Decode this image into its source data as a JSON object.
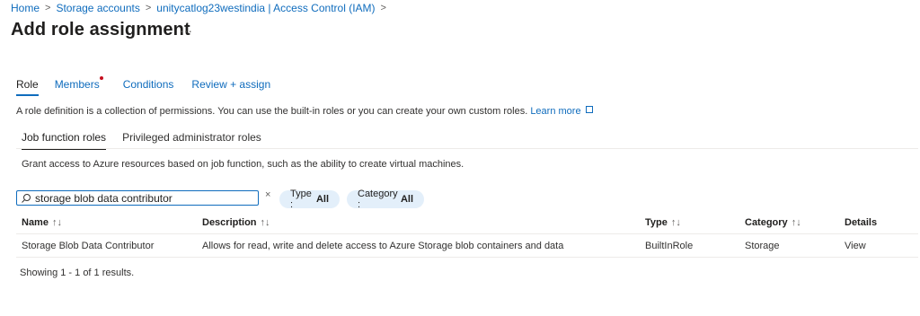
{
  "breadcrumb": {
    "items": [
      "Home",
      "Storage accounts",
      "unitycatlog23westindia | Access Control (IAM)"
    ],
    "separator": ">"
  },
  "page": {
    "title": "Add role assignment",
    "more": "···"
  },
  "tabs": [
    {
      "label": "Role",
      "active": true
    },
    {
      "label": "Members",
      "active": false,
      "required_dot": true
    },
    {
      "label": "Conditions",
      "active": false
    },
    {
      "label": "Review + assign",
      "active": false
    }
  ],
  "role_description": {
    "text": "A role definition is a collection of permissions. You can use the built-in roles or you can create your own custom roles.",
    "link": "Learn more"
  },
  "subtabs": [
    {
      "label": "Job function roles",
      "active": true
    },
    {
      "label": "Privileged administrator roles",
      "active": false
    }
  ],
  "subtab_description": "Grant access to Azure resources based on job function, such as the ability to create virtual machines.",
  "search": {
    "value": "storage blob data contributor",
    "clear": "×"
  },
  "filters": {
    "type_label": "Type : ",
    "type_value": "All",
    "category_label": "Category : ",
    "category_value": "All"
  },
  "table": {
    "columns": [
      {
        "label": "Name",
        "sort": "↑↓"
      },
      {
        "label": "Description",
        "sort": "↑↓"
      },
      {
        "label": "Type",
        "sort": "↑↓"
      },
      {
        "label": "Category",
        "sort": "↑↓"
      },
      {
        "label": "Details",
        "sort": ""
      }
    ],
    "rows": [
      {
        "name": "Storage Blob Data Contributor",
        "description": "Allows for read, write and delete access to Azure Storage blob containers and data",
        "type": "BuiltInRole",
        "category": "Storage",
        "details": "View"
      }
    ]
  },
  "footer": "Showing 1 - 1 of 1 results.",
  "colors": {
    "accent": "#0f6cbd",
    "required": "#c50f1f",
    "pill_bg": "#e3effa"
  }
}
